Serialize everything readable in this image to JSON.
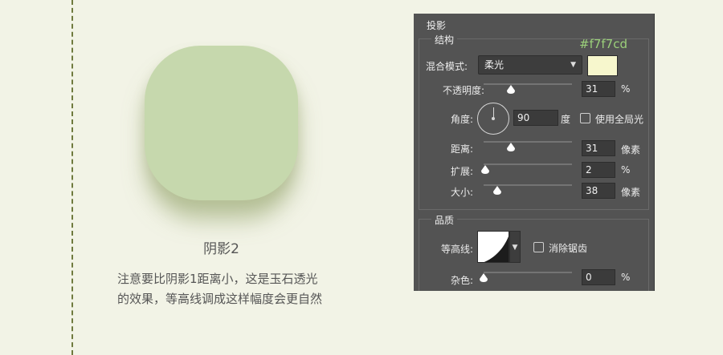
{
  "caption": {
    "title": "阴影2",
    "line1": "注意要比阴影1距离小，这是玉石透光",
    "line2": "的效果，等高线调成这样幅度会更自然"
  },
  "colors": {
    "background": "#f2f3e6",
    "shape_fill": "#c6d8ad",
    "swatch": "#f7f7cd",
    "hex_label_color": "#9bd07a",
    "panel_bg": "#535353"
  },
  "panel": {
    "title": "投影",
    "structure": {
      "label": "结构",
      "blend_mode_label": "混合模式:",
      "blend_mode_value": "柔光",
      "swatch_hex": "#f7f7cd",
      "opacity_label": "不透明度:",
      "opacity_value": "31",
      "opacity_unit": "%",
      "opacity_level": 0.31,
      "angle_label": "角度:",
      "angle_value": "90",
      "angle_unit": "度",
      "global_light_label": "使用全局光",
      "global_light_checked": false,
      "distance_label": "距离:",
      "distance_value": "31",
      "distance_unit": "像素",
      "distance_level": 0.31,
      "spread_label": "扩展:",
      "spread_value": "2",
      "spread_unit": "%",
      "spread_level": 0.02,
      "size_label": "大小:",
      "size_value": "38",
      "size_unit": "像素",
      "size_level": 0.15
    },
    "quality": {
      "label": "品质",
      "contour_label": "等高线:",
      "anti_alias_label": "消除锯齿",
      "anti_alias_checked": false,
      "noise_label": "杂色:",
      "noise_value": "0",
      "noise_unit": "%",
      "noise_level": 0
    }
  }
}
